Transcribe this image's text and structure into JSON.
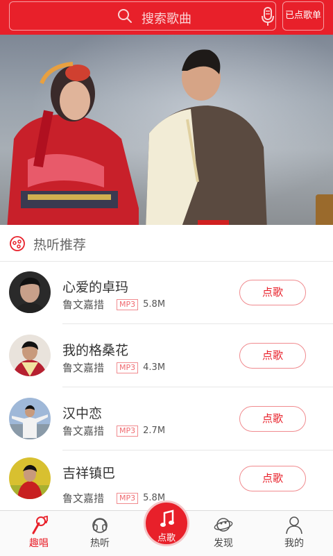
{
  "header": {
    "search_placeholder": "搜索歌曲",
    "queue_button": "已点歌单"
  },
  "banner": {
    "slide_count": 10,
    "active_index": 0
  },
  "section": {
    "title": "热听推荐"
  },
  "songs": [
    {
      "name": "心爱的卓玛",
      "artist": "鲁文嘉措",
      "format": "MP3",
      "size": "5.8M",
      "button": "点歌"
    },
    {
      "name": "我的格桑花",
      "artist": "鲁文嘉措",
      "format": "MP3",
      "size": "4.3M",
      "button": "点歌"
    },
    {
      "name": "汉中恋",
      "artist": "鲁文嘉措",
      "format": "MP3",
      "size": "2.7M",
      "button": "点歌"
    },
    {
      "name": "吉祥镇巴",
      "artist": "鲁文嘉措",
      "format": "MP3",
      "size": "5.8M",
      "button": "点歌"
    }
  ],
  "nav": {
    "items": [
      {
        "label": "趣唱",
        "icon": "sing-icon"
      },
      {
        "label": "热听",
        "icon": "headphones-icon"
      },
      {
        "label": "点歌",
        "icon": "music-note-icon"
      },
      {
        "label": "发现",
        "icon": "planet-icon"
      },
      {
        "label": "我的",
        "icon": "user-icon"
      }
    ]
  },
  "colors": {
    "accent": "#e8202a",
    "accent_light": "#f08a8e"
  }
}
